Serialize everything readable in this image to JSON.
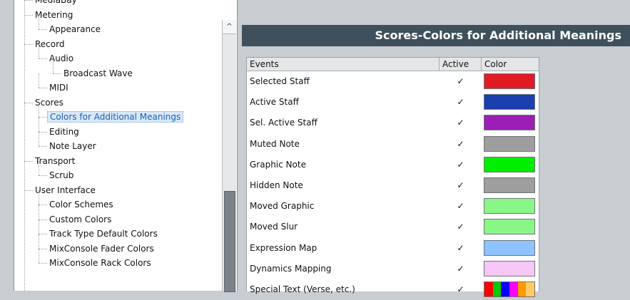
{
  "tree": {
    "items": [
      {
        "label": "MediaBay",
        "level": 1
      },
      {
        "label": "Metering",
        "level": 1
      },
      {
        "label": "Appearance",
        "level": 2
      },
      {
        "label": "Record",
        "level": 1
      },
      {
        "label": "Audio",
        "level": 2
      },
      {
        "label": "Broadcast Wave",
        "level": 3
      },
      {
        "label": "MIDI",
        "level": 2
      },
      {
        "label": "Scores",
        "level": 1
      },
      {
        "label": "Colors for Additional Meanings",
        "level": 2,
        "selected": true
      },
      {
        "label": "Editing",
        "level": 2
      },
      {
        "label": "Note Layer",
        "level": 2
      },
      {
        "label": "Transport",
        "level": 1
      },
      {
        "label": "Scrub",
        "level": 2
      },
      {
        "label": "User Interface",
        "level": 1
      },
      {
        "label": "Color Schemes",
        "level": 2
      },
      {
        "label": "Custom Colors",
        "level": 2
      },
      {
        "label": "Track Type Default Colors",
        "level": 2
      },
      {
        "label": "MixConsole Fader Colors",
        "level": 2
      },
      {
        "label": "MixConsole Rack Colors",
        "level": 2
      }
    ]
  },
  "scrollbar": {
    "up_arrow": "^"
  },
  "header": {
    "title": "Scores-Colors for Additional Meanings"
  },
  "table": {
    "columns": {
      "events": "Events",
      "active": "Active",
      "color": "Color"
    },
    "rows": [
      {
        "event": "Selected Staff",
        "active": "✓",
        "color": "#e01b24"
      },
      {
        "event": "Active Staff",
        "active": "✓",
        "color": "#1c3fae"
      },
      {
        "event": "Sel. Active Staff",
        "active": "✓",
        "color": "#9b1fb5"
      },
      {
        "event": "Muted Note",
        "active": "✓",
        "color": "#9e9e9e"
      },
      {
        "event": "Graphic Note",
        "active": "✓",
        "color": "#00ee00"
      },
      {
        "event": "Hidden Note",
        "active": "✓",
        "color": "#9e9e9e"
      },
      {
        "event": "Moved Graphic",
        "active": "✓",
        "color": "#88f788"
      },
      {
        "event": "Moved Slur",
        "active": "✓",
        "color": "#88f788"
      },
      {
        "event": "Expression Map",
        "active": "✓",
        "color": "#8fc3ff"
      },
      {
        "event": "Dynamics Mapping",
        "active": "✓",
        "color": "#f7c7f7"
      },
      {
        "event": "Special Text (Verse, etc.)",
        "active": "✓",
        "color": "multi",
        "stripes": [
          "#ff0000",
          "#00cc00",
          "#0000ff",
          "#ff00ff",
          "#ff9900",
          "#ffcc66"
        ]
      }
    ]
  }
}
